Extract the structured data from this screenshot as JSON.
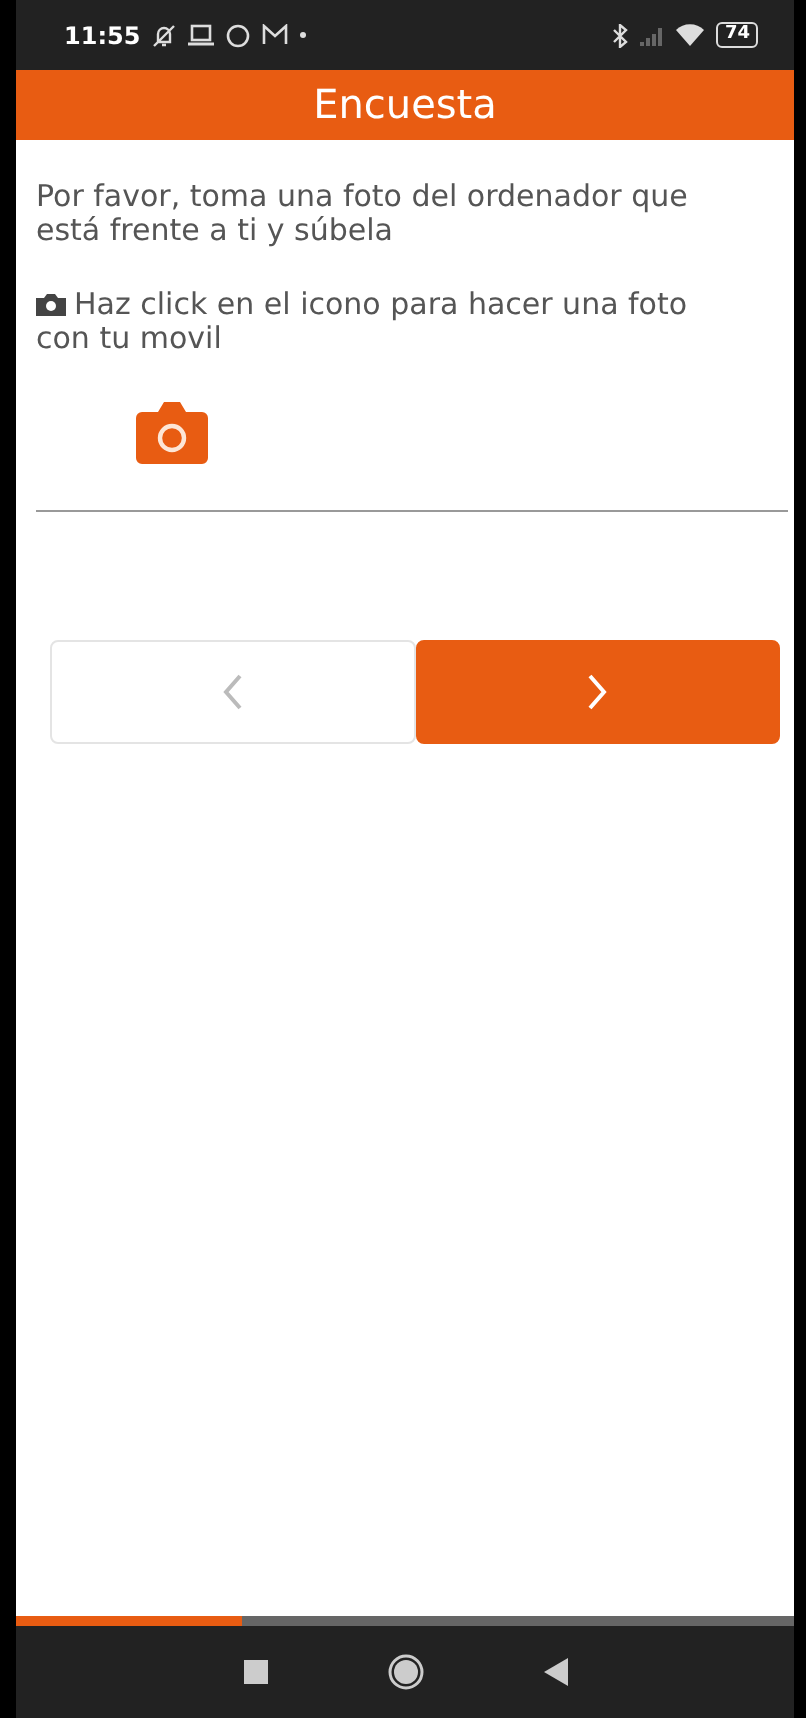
{
  "status_bar": {
    "time": "11:55",
    "battery": "74"
  },
  "header": {
    "title": "Encuesta"
  },
  "question": {
    "text": "Por favor, toma una foto del ordenador que está frente a ti y súbela",
    "hint": "Haz click en el icono para hacer una foto con tu movil"
  },
  "nav_buttons": [
    {
      "kind": "prev",
      "disabled": true
    },
    {
      "kind": "next",
      "disabled": false
    }
  ],
  "progress": {
    "level": 0.29
  }
}
